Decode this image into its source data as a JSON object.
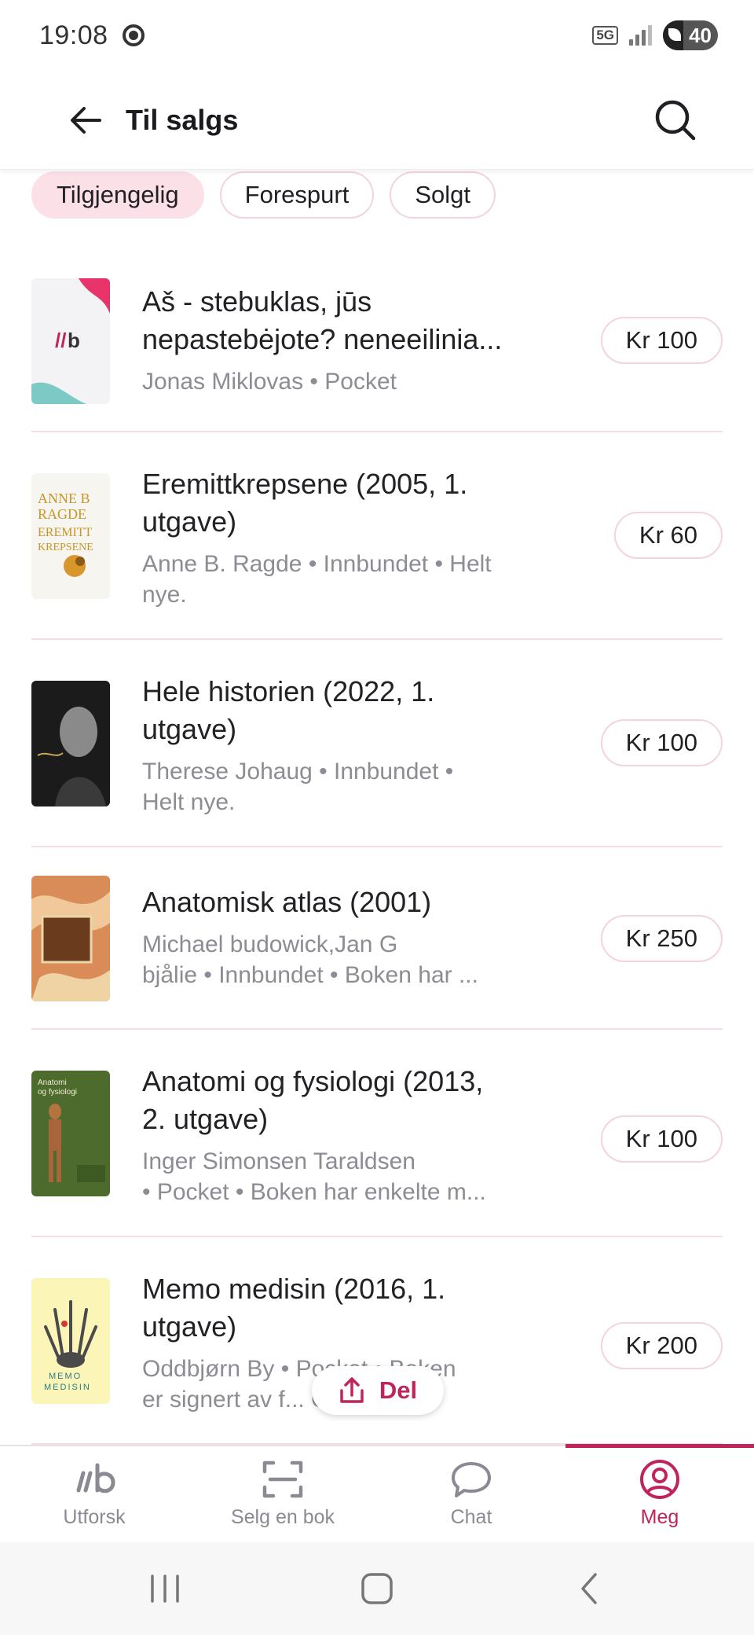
{
  "status_bar": {
    "time": "19:08",
    "network": "5G",
    "battery": "40"
  },
  "header": {
    "title": "Til salgs"
  },
  "filters": [
    {
      "label": "Tilgjengelig",
      "active": true
    },
    {
      "label": "Forespurt",
      "active": false
    },
    {
      "label": "Solgt",
      "active": false
    }
  ],
  "listings": [
    {
      "title_lines": [
        "Aš - stebuklas, jūs",
        "nepastebėjote? neneeilinia..."
      ],
      "meta_lines": [
        "Jonas Miklovas • Pocket"
      ],
      "price": "Kr 100"
    },
    {
      "title_lines": [
        "Eremittkrepsene (2005, 1.",
        "utgave)"
      ],
      "meta_lines": [
        "Anne B. Ragde • Innbundet • Helt",
        "nye."
      ],
      "price": "Kr 60",
      "cover_text": "ANNE B RAGDE EREMITT KREPSENE"
    },
    {
      "title_lines": [
        "Hele historien (2022, 1.",
        "utgave)"
      ],
      "meta_lines": [
        "Therese Johaug • Innbundet •",
        "Helt nye."
      ],
      "price": "Kr 100"
    },
    {
      "title_lines": [
        "Anatomisk atlas (2001)"
      ],
      "meta_lines": [
        "Michael budowick,Jan G",
        "bjålie • Innbundet • Boken har ..."
      ],
      "price": "Kr 250"
    },
    {
      "title_lines": [
        "Anatomi og  fysiologi (2013,",
        "2. utgave)"
      ],
      "meta_lines": [
        "Inger Simonsen Taraldsen",
        "• Pocket • Boken har enkelte m..."
      ],
      "price": "Kr 100",
      "cover_text": "Anatomi og fysiologi"
    },
    {
      "title_lines": [
        "Memo medisin (2016, 1.",
        "utgave)"
      ],
      "meta_lines": [
        "Oddbjørn By • Pocket • Boken",
        "er signert av f... Oddbj..."
      ],
      "price": "Kr 200",
      "cover_text": "MEMO MEDISIN"
    }
  ],
  "share": {
    "label": "Del"
  },
  "nav": [
    {
      "label": "Utforsk",
      "icon": "lb-logo-icon",
      "active": false
    },
    {
      "label": "Selg en bok",
      "icon": "scan-icon",
      "active": false
    },
    {
      "label": "Chat",
      "icon": "chat-bubble-icon",
      "active": false
    },
    {
      "label": "Meg",
      "icon": "profile-icon",
      "active": true
    }
  ],
  "colors": {
    "accent": "#c0245c",
    "chip_active": "#fbe0e7",
    "divider": "#f5dde3"
  }
}
